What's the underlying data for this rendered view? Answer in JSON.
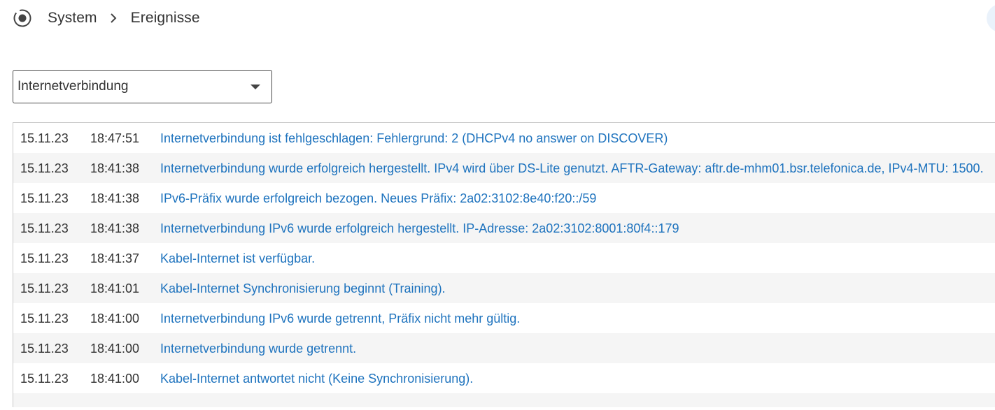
{
  "breadcrumb": {
    "root": "System",
    "current": "Ereignisse"
  },
  "icons": {
    "header": "radio-dot-icon",
    "separator": "chevron-right-icon",
    "dropdown": "caret-down-icon"
  },
  "filter": {
    "selected": "Internetverbindung"
  },
  "colors": {
    "link": "#1e73be",
    "text": "#333333",
    "row_alt": "#f5f5f5"
  },
  "events": [
    {
      "date": "15.11.23",
      "time": "18:47:51",
      "message": "Internetverbindung ist fehlgeschlagen: Fehlergrund: 2 (DHCPv4 no answer on DISCOVER)"
    },
    {
      "date": "15.11.23",
      "time": "18:41:38",
      "message": "Internetverbindung wurde erfolgreich hergestellt. IPv4 wird über DS-Lite genutzt. AFTR-Gateway: aftr.de-mhm01.bsr.telefonica.de, IPv4-MTU: 1500."
    },
    {
      "date": "15.11.23",
      "time": "18:41:38",
      "message": "IPv6-Präfix wurde erfolgreich bezogen. Neues Präfix: 2a02:3102:8e40:f20::/59"
    },
    {
      "date": "15.11.23",
      "time": "18:41:38",
      "message": "Internetverbindung IPv6 wurde erfolgreich hergestellt. IP-Adresse: 2a02:3102:8001:80f4::179"
    },
    {
      "date": "15.11.23",
      "time": "18:41:37",
      "message": "Kabel-Internet ist verfügbar."
    },
    {
      "date": "15.11.23",
      "time": "18:41:01",
      "message": "Kabel-Internet Synchronisierung beginnt (Training)."
    },
    {
      "date": "15.11.23",
      "time": "18:41:00",
      "message": "Internetverbindung IPv6 wurde getrennt, Präfix nicht mehr gültig."
    },
    {
      "date": "15.11.23",
      "time": "18:41:00",
      "message": "Internetverbindung wurde getrennt."
    },
    {
      "date": "15.11.23",
      "time": "18:41:00",
      "message": "Kabel-Internet antwortet nicht (Keine Synchronisierung)."
    }
  ]
}
